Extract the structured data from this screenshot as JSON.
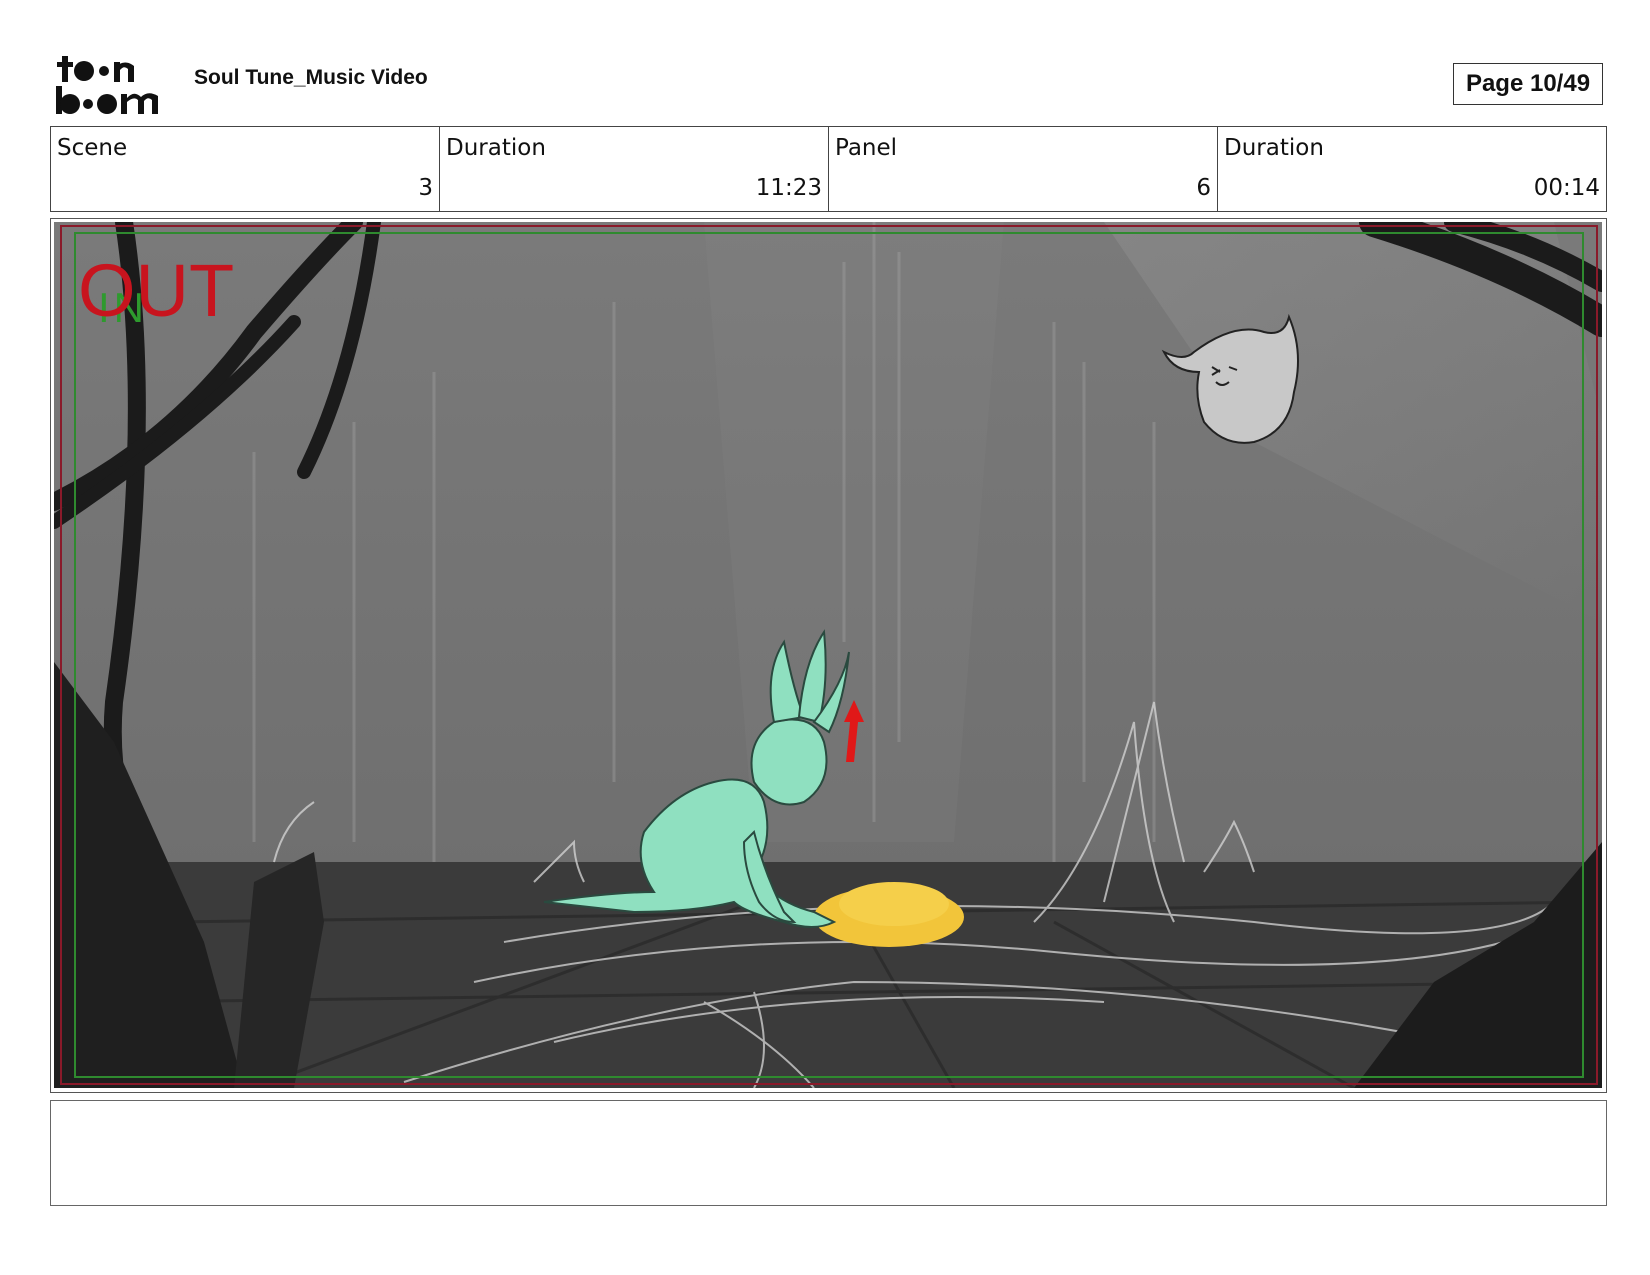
{
  "header": {
    "project_title": "Soul Tune_Music Video",
    "page_label": "Page 10/49",
    "logo_text_top": "toon",
    "logo_text_bottom": "boom"
  },
  "info": {
    "scene_label": "Scene",
    "scene_value": "3",
    "scene_duration_label": "Duration",
    "scene_duration_value": "11:23",
    "panel_label": "Panel",
    "panel_value": "6",
    "panel_duration_label": "Duration",
    "panel_duration_value": "00:14"
  },
  "panel": {
    "out_label": "OUT",
    "in_label": "IN",
    "colors": {
      "safe_frame_red": "#8a1a2a",
      "safe_frame_green": "#2f8a2f",
      "character": "#8fe0c0",
      "glow_object": "#f2c53a",
      "arrow": "#e01818",
      "sky": "#777777",
      "floor": "#3d3d3d"
    }
  },
  "notes": {
    "text": ""
  }
}
